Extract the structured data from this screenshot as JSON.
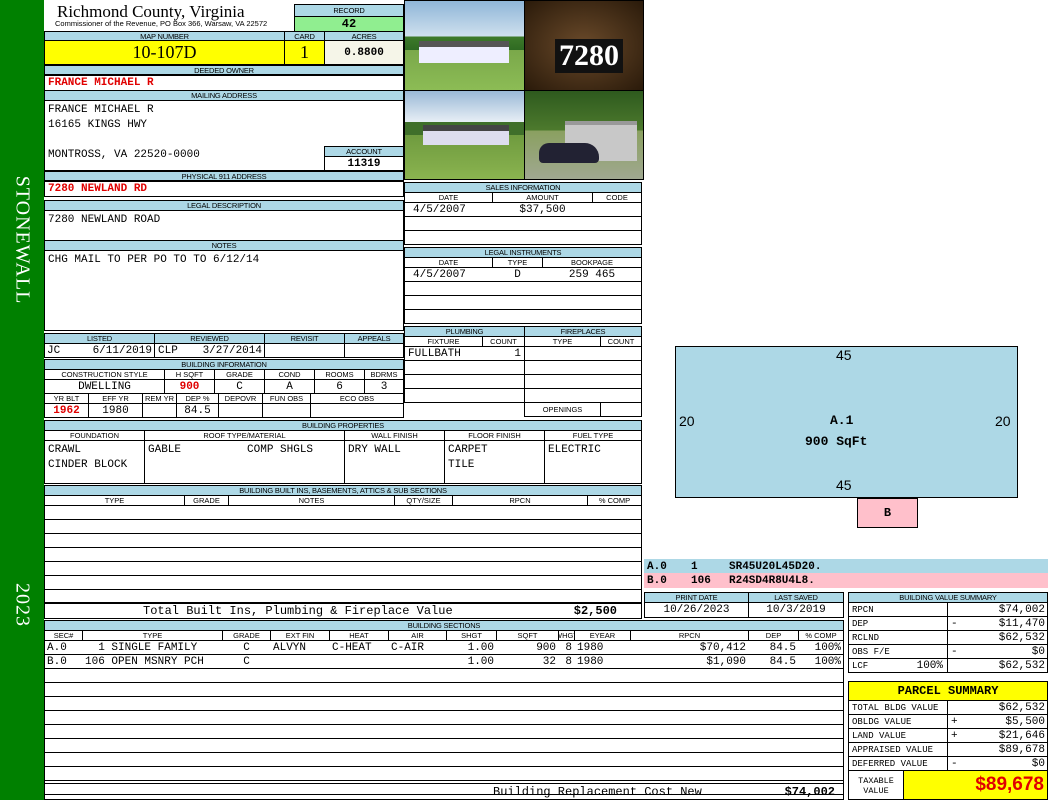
{
  "sidebar": {
    "district": "STONEWALL",
    "year": "2023"
  },
  "header": {
    "county": "Richmond County, Virginia",
    "office": "Commissioner of the Revenue, PO Box 366, Warsaw, VA 22572",
    "record_label": "RECORD",
    "record": "42"
  },
  "parcel": {
    "map_label": "MAP NUMBER",
    "map": "10-107D",
    "card_label": "CARD",
    "card": "1",
    "acres_label": "ACRES",
    "acres": "0.8800"
  },
  "owner": {
    "label": "DEEDED OWNER",
    "name": "FRANCE MICHAEL R"
  },
  "mailing": {
    "label": "MAILING ADDRESS",
    "address": "FRANCE MICHAEL R\n16165 KINGS HWY\n\nMONTROSS, VA 22520-0000",
    "account_label": "ACCOUNT",
    "account": "11319"
  },
  "physical": {
    "label": "PHYSICAL 911 ADDRESS",
    "address": "7280 NEWLAND RD"
  },
  "legal": {
    "label": "LEGAL DESCRIPTION",
    "text": "7280 NEWLAND ROAD"
  },
  "notes": {
    "label": "NOTES",
    "text": "CHG MAIL TO PER PO TO TO 6/12/14"
  },
  "review": {
    "listed_label": "LISTED",
    "listed_by": "JC",
    "listed": "6/11/2019",
    "reviewed_label": "REVIEWED",
    "reviewed_by": "CLP",
    "reviewed": "3/27/2014",
    "revisit_label": "REVISIT",
    "appeals_label": "APPEALS"
  },
  "bldg_info": {
    "label": "BUILDING INFORMATION",
    "h": [
      "CONSTRUCTION STYLE",
      "H SQFT",
      "GRADE",
      "COND",
      "ROOMS",
      "BDRMS"
    ],
    "v": [
      "DWELLING",
      "900",
      "C",
      "A",
      "6",
      "3"
    ],
    "h2": [
      "YR BLT",
      "EFF YR",
      "REM YR",
      "DEP %",
      "DEPOVR",
      "FUN OBS",
      "ECO OBS"
    ],
    "v2": [
      "1962",
      "1980",
      "",
      "84.5",
      "",
      "",
      ""
    ]
  },
  "bldg_props": {
    "label": "BUILDING PROPERTIES",
    "h": [
      "FOUNDATION",
      "ROOF TYPE/MATERIAL",
      "WALL FINISH",
      "FLOOR FINISH",
      "FUEL TYPE"
    ],
    "v": [
      "CRAWL\nCINDER BLOCK",
      "GABLE          COMP SHGLS",
      "DRY WALL",
      "CARPET\nTILE",
      "ELECTRIC"
    ]
  },
  "builtins": {
    "label": "BUILDING BUILT INS, BASEMENTS, ATTICS & SUB SECTIONS",
    "h": [
      "TYPE",
      "GRADE",
      "NOTES",
      "QTY/SIZE",
      "RPCN",
      "% COMP"
    ],
    "total_label": "Total Built Ins, Plumbing & Fireplace Value",
    "total": "$2,500"
  },
  "photos": {
    "house_number": "7280"
  },
  "sales": {
    "label": "SALES INFORMATION",
    "h": [
      "DATE",
      "AMOUNT",
      "CODE"
    ],
    "rows": [
      [
        "4/5/2007",
        "$37,500",
        ""
      ]
    ]
  },
  "instruments": {
    "label": "LEGAL INSTRUMENTS",
    "h": [
      "DATE",
      "TYPE",
      "BOOKPAGE"
    ],
    "rows": [
      [
        "4/5/2007",
        "D",
        "259 465"
      ]
    ]
  },
  "plumbing": {
    "label": "PLUMBING",
    "h": [
      "FIXTURE",
      "COUNT"
    ],
    "rows": [
      [
        "FULLBATH",
        "1"
      ]
    ]
  },
  "fireplaces": {
    "label": "FIREPLACES",
    "h": [
      "TYPE",
      "COUNT"
    ],
    "openings_label": "OPENINGS"
  },
  "sketch": {
    "top": "45",
    "bottom": "45",
    "left": "20",
    "right": "20",
    "section": "A.1",
    "area": "900 SqFt",
    "addon": "B",
    "vectors": [
      [
        "A.0",
        "1",
        "SR45U20L45D20."
      ],
      [
        "B.0",
        "106",
        "R24SD4R8U4L8."
      ]
    ]
  },
  "dates": {
    "print_label": "PRINT DATE",
    "print": "10/26/2023",
    "saved_label": "LAST SAVED",
    "saved": "10/3/2019"
  },
  "sections": {
    "label": "BUILDING SECTIONS",
    "h": [
      "SEC#",
      "TYPE",
      "GRADE",
      "EXT FIN",
      "HEAT",
      "AIR",
      "SHGT",
      "SQFT",
      "WHGT",
      "EYEAR",
      "RPCN",
      "DEP",
      "% COMP"
    ],
    "rows": [
      [
        "A.0",
        "  1 SINGLE FAMILY",
        "C",
        "ALVYN",
        "C-HEAT",
        "C-AIR",
        "1.00",
        "900",
        "8",
        "1980",
        "$70,412",
        "84.5",
        "100%"
      ],
      [
        "B.0",
        "106 OPEN MSNRY PCH",
        "C",
        "",
        "",
        "",
        "1.00",
        "32",
        "8",
        "1980",
        "$1,090",
        "84.5",
        "100%"
      ]
    ],
    "total_label": "Building Replacement Cost New",
    "total": "$74,002"
  },
  "value_summary": {
    "label": "BUILDING VALUE SUMMARY",
    "rows": [
      [
        "RPCN",
        "",
        "",
        "$74,002"
      ],
      [
        "DEP",
        "",
        "-",
        "$11,470"
      ],
      [
        "RCLND",
        "",
        "",
        "$62,532"
      ],
      [
        "OBS F/E",
        "",
        "-",
        "$0"
      ],
      [
        "LCF",
        "100%",
        "",
        "$62,532"
      ]
    ]
  },
  "parcel_summary": {
    "label": "PARCEL SUMMARY",
    "rows": [
      [
        "TOTAL BLDG VALUE",
        "",
        "$62,532"
      ],
      [
        "OBLDG VALUE",
        "+",
        "$5,500"
      ],
      [
        "LAND VALUE",
        "+",
        "$21,646"
      ],
      [
        "APPRAISED VALUE",
        "",
        "$89,678"
      ],
      [
        "DEFERRED VALUE",
        "-",
        "$0"
      ]
    ],
    "taxable_label": "TAXABLE\nVALUE",
    "taxable": "$89,678"
  },
  "colors": {
    "header": "#add8e6",
    "sidebar": "#008000",
    "highlight": "#ffff00",
    "record": "#90ee90",
    "pink": "#ffc0cb",
    "red": "#e00000"
  }
}
